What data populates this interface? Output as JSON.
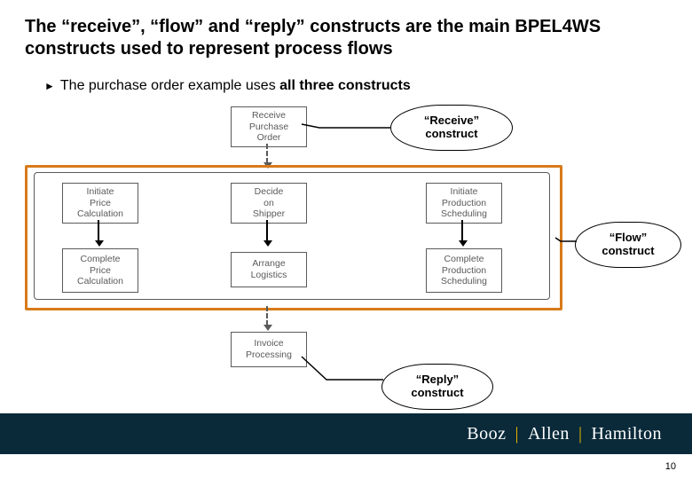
{
  "title": "The “receive”, “flow” and “reply” constructs are the main BPEL4WS constructs used to represent process flows",
  "bullet_prefix": "The purchase order example uses ",
  "bullet_bold": "all three constructs",
  "boxes": {
    "receive": "Receive\nPurchase\nOrder",
    "initPrice": "Initiate\nPrice\nCalculation",
    "decideShipper": "Decide\non\nShipper",
    "initProd": "Initiate\nProduction\nScheduling",
    "completePrice": "Complete\nPrice\nCalculation",
    "arrangeLog": "Arrange\nLogistics",
    "completeProd": "Complete\nProduction\nScheduling",
    "invoice": "Invoice\nProcessing"
  },
  "callouts": {
    "receive": "“Receive”\nconstruct",
    "flow": "“Flow”\nconstruct",
    "reply": "“Reply”\nconstruct"
  },
  "logo": {
    "a": "Booz",
    "b": "Allen",
    "c": "Hamilton"
  },
  "page": "10"
}
